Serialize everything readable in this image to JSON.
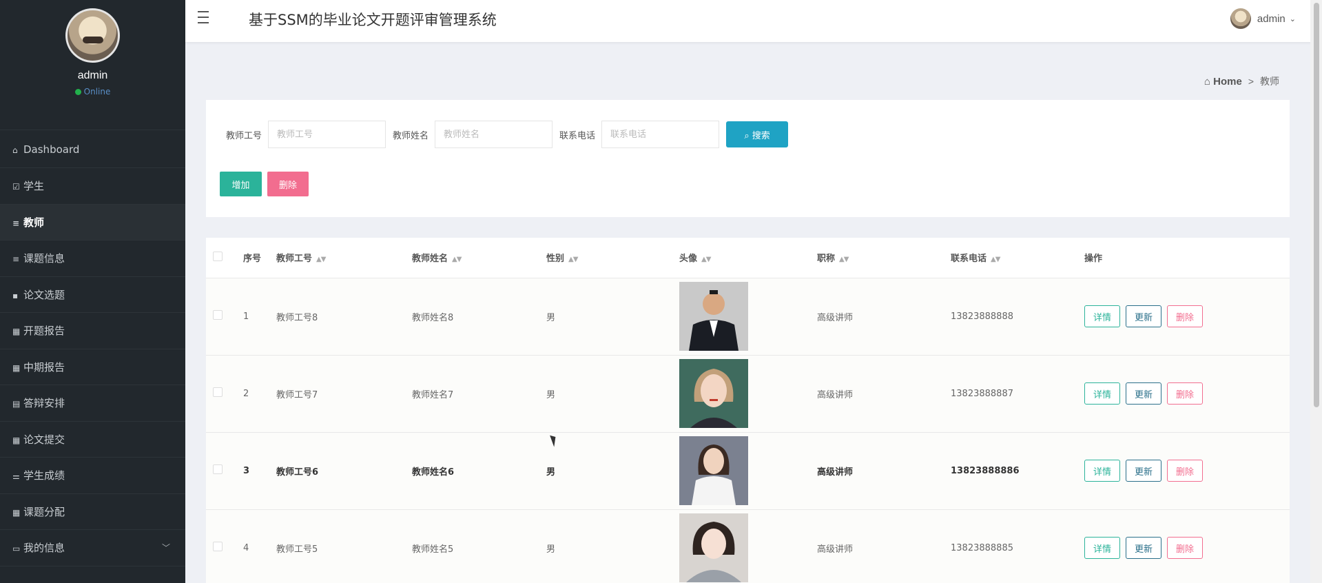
{
  "sidebar": {
    "username": "admin",
    "status": "Online",
    "items": [
      {
        "label": "Dashboard",
        "icon": "home-icon"
      },
      {
        "label": "学生",
        "icon": "checkbox-icon"
      },
      {
        "label": "教师",
        "icon": "list-icon"
      },
      {
        "label": "课题信息",
        "icon": "list-icon"
      },
      {
        "label": "论文选题",
        "icon": "comment-icon"
      },
      {
        "label": "开题报告",
        "icon": "grid-icon"
      },
      {
        "label": "中期报告",
        "icon": "grid-icon"
      },
      {
        "label": "答辩安排",
        "icon": "table-icon"
      },
      {
        "label": "论文提交",
        "icon": "grid-icon"
      },
      {
        "label": "学生成绩",
        "icon": "sliders-icon"
      },
      {
        "label": "课题分配",
        "icon": "grid-icon"
      },
      {
        "label": "我的信息",
        "icon": "profile-icon"
      }
    ]
  },
  "header": {
    "title": "基于SSM的毕业论文开题评审管理系统",
    "user": "admin"
  },
  "breadcrumb": {
    "home": "Home",
    "separator": ">",
    "current": "教师"
  },
  "search": {
    "fields": [
      {
        "label": "教师工号",
        "placeholder": "教师工号",
        "value": ""
      },
      {
        "label": "教师姓名",
        "placeholder": "教师姓名",
        "value": ""
      },
      {
        "label": "联系电话",
        "placeholder": "联系电话",
        "value": ""
      }
    ],
    "button": "搜索",
    "add": "增加",
    "delete": "删除"
  },
  "table": {
    "headers": [
      "序号",
      "教师工号",
      "教师姓名",
      "性别",
      "头像",
      "职称",
      "联系电话",
      "操作"
    ],
    "rows": [
      {
        "no": "1",
        "id": "教师工号8",
        "name": "教师姓名8",
        "gender": "男",
        "title": "高级讲师",
        "phone": "13823888888"
      },
      {
        "no": "2",
        "id": "教师工号7",
        "name": "教师姓名7",
        "gender": "男",
        "title": "高级讲师",
        "phone": "13823888887"
      },
      {
        "no": "3",
        "id": "教师工号6",
        "name": "教师姓名6",
        "gender": "男",
        "title": "高级讲师",
        "phone": "13823888886"
      },
      {
        "no": "4",
        "id": "教师工号5",
        "name": "教师姓名5",
        "gender": "男",
        "title": "高级讲师",
        "phone": "13823888885"
      }
    ],
    "actions": {
      "detail": "详情",
      "update": "更新",
      "delete": "删除"
    }
  },
  "colors": {
    "sidebar_bg": "#22282d",
    "search_btn": "#1fa3c4",
    "add_btn": "#2bb39a",
    "delete_btn": "#f26d8f",
    "online_dot": "#22b14c"
  }
}
